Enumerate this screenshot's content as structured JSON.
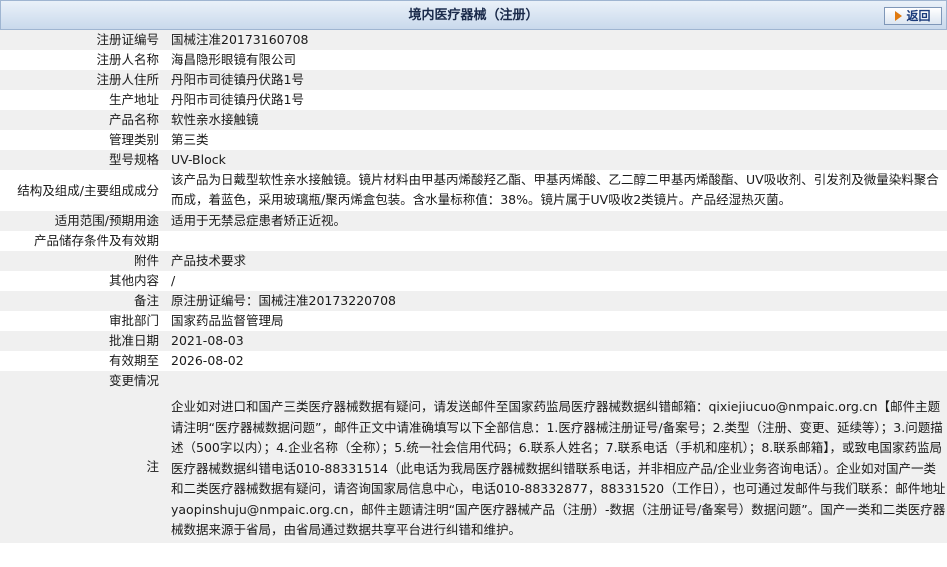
{
  "header": {
    "title": "境内医疗器械（注册）",
    "back_label": "返回"
  },
  "rows": [
    {
      "label": "注册证编号",
      "value": "国械注准20173160708"
    },
    {
      "label": "注册人名称",
      "value": "海昌隐形眼镜有限公司"
    },
    {
      "label": "注册人住所",
      "value": "丹阳市司徒镇丹伏路1号"
    },
    {
      "label": "生产地址",
      "value": "丹阳市司徒镇丹伏路1号"
    },
    {
      "label": "产品名称",
      "value": "软性亲水接触镜"
    },
    {
      "label": "管理类别",
      "value": "第三类"
    },
    {
      "label": "型号规格",
      "value": "UV-Block"
    },
    {
      "label": "结构及组成/主要组成成分",
      "value": "该产品为日戴型软性亲水接触镜。镜片材料由甲基丙烯酸羟乙酯、甲基丙烯酸、乙二醇二甲基丙烯酸酯、UV吸收剂、引发剂及微量染料聚合而成，着蓝色，采用玻璃瓶/聚丙烯盒包装。含水量标称值：38%。镜片属于UV吸收2类镜片。产品经湿热灭菌。"
    },
    {
      "label": "适用范围/预期用途",
      "value": "适用于无禁忌症患者矫正近视。"
    },
    {
      "label": "产品储存条件及有效期",
      "value": ""
    },
    {
      "label": "附件",
      "value": "产品技术要求"
    },
    {
      "label": "其他内容",
      "value": "/"
    },
    {
      "label": "备注",
      "value": "原注册证编号：国械注准20173220708"
    },
    {
      "label": "审批部门",
      "value": "国家药品监督管理局"
    },
    {
      "label": "批准日期",
      "value": "2021-08-03"
    },
    {
      "label": "有效期至",
      "value": "2026-08-02"
    },
    {
      "label": "变更情况",
      "value": ""
    }
  ],
  "note": {
    "label": "注",
    "text": "企业如对进口和国产三类医疗器械数据有疑问，请发送邮件至国家药监局医疗器械数据纠错邮箱：qixiejiucuo@nmpaic.org.cn【邮件主题请注明“医疗器械数据问题”，邮件正文中请准确填写以下全部信息：1.医疗器械注册证号/备案号；2.类型（注册、变更、延续等）；3.问题描述（500字以内）；4.企业名称（全称）；5.统一社会信用代码；6.联系人姓名；7.联系电话（手机和座机）；8.联系邮箱】，或致电国家药监局医疗器械数据纠错电话010-88331514（此电话为我局医疗器械数据纠错联系电话，并非相应产品/企业业务咨询电话）。企业如对国产一类和二类医疗器械数据有疑问，请咨询国家局信息中心，电话010-88332877，88331520（工作日），也可通过发邮件与我们联系：邮件地址yaopinshuju@nmpaic.org.cn，邮件主题请注明“国产医疗器械产品（注册）-数据（注册证号/备案号）数据问题”。国产一类和二类医疗器械数据来源于省局，由省局通过数据共享平台进行纠错和维护。"
  }
}
